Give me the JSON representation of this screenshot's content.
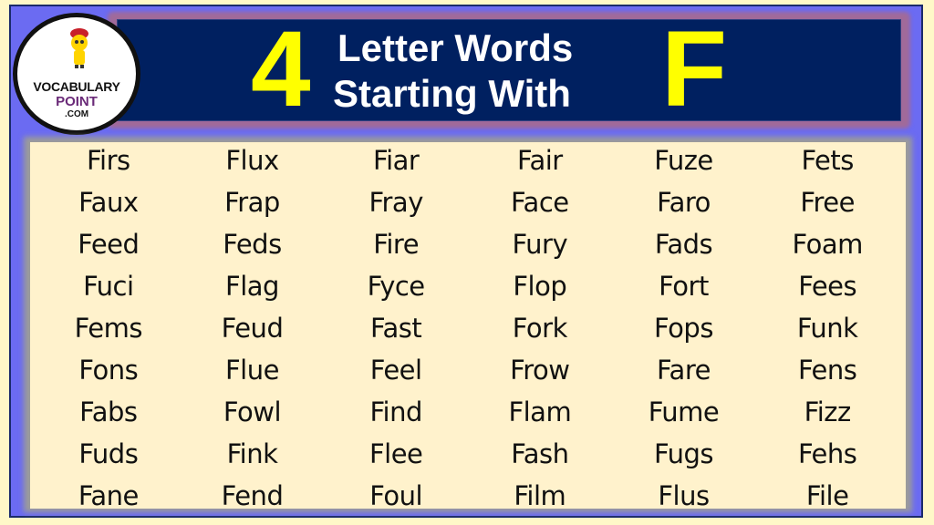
{
  "header": {
    "number": "4",
    "title_line1": "Letter Words",
    "title_line2": "Starting With",
    "letter": "F"
  },
  "logo": {
    "line1": "VOCABULARY",
    "line2": "POINT",
    "line3": ".COM",
    "icon": "mascot-with-book-icon"
  },
  "colors": {
    "banner_bg": "#002060",
    "accent_yellow": "#ffff00",
    "frame_blue": "#6b6bf2",
    "panel_bg": "#fff2cc",
    "logo_purple": "#6a2a78"
  },
  "words": [
    [
      "Firs",
      "Flux",
      "Fiar",
      "Fair",
      "Fuze",
      "Fets"
    ],
    [
      "Faux",
      "Frap",
      "Fray",
      "Face",
      "Faro",
      "Free"
    ],
    [
      "Feed",
      "Feds",
      "Fire",
      "Fury",
      "Fads",
      "Foam"
    ],
    [
      "Fuci",
      "Flag",
      "Fyce",
      "Flop",
      "Fort",
      "Fees"
    ],
    [
      "Fems",
      "Feud",
      "Fast",
      "Fork",
      "Fops",
      "Funk"
    ],
    [
      "Fons",
      "Flue",
      "Feel",
      "Frow",
      "Fare",
      "Fens"
    ],
    [
      "Fabs",
      "Fowl",
      "Find",
      "Flam",
      "Fume",
      "Fizz"
    ],
    [
      "Fuds",
      "Fink",
      "Flee",
      "Fash",
      "Fugs",
      "Fehs"
    ],
    [
      "Fane",
      "Fend",
      "Foul",
      "Film",
      "Flus",
      "File"
    ]
  ]
}
